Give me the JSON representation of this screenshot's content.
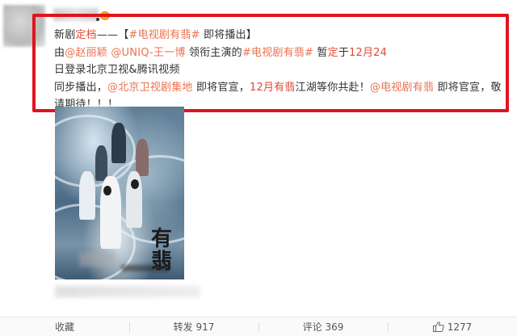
{
  "post": {
    "avatar": "blurred-avatar",
    "username": "",
    "line1": [
      {
        "text": "新剧",
        "style": "plain"
      },
      {
        "text": "定档",
        "style": "red"
      },
      {
        "text": "——【",
        "style": "plain"
      },
      {
        "text": "#电视剧有翡#",
        "style": "link"
      },
      {
        "text": " 即将播出】",
        "style": "plain"
      }
    ],
    "line2": [
      {
        "text": "由",
        "style": "plain"
      },
      {
        "text": "@赵丽颖",
        "style": "link"
      },
      {
        "text": " ",
        "style": "plain"
      },
      {
        "text": "@UNIQ-王一博",
        "style": "link"
      },
      {
        "text": " 领衔主演的",
        "style": "plain"
      },
      {
        "text": "#电视剧有翡#",
        "style": "link"
      },
      {
        "text": " 暂",
        "style": "plain"
      },
      {
        "text": "定",
        "style": "red"
      },
      {
        "text": "于",
        "style": "plain"
      },
      {
        "text": "12月24",
        "style": "red"
      },
      {
        "text": "日登录北京卫视&腾讯视频",
        "style": "plain"
      }
    ],
    "line3": [
      {
        "text": "同步播出，",
        "style": "plain"
      },
      {
        "text": "@北京卫视剧集地",
        "style": "link"
      },
      {
        "text": " 即将官宣，",
        "style": "plain"
      },
      {
        "text": "12月有翡",
        "style": "red"
      },
      {
        "text": "江湖等你共赴！",
        "style": "plain"
      },
      {
        "text": "@电视剧有翡",
        "style": "link"
      },
      {
        "text": " 即将官宣，敬",
        "style": "plain"
      }
    ],
    "line4": [
      {
        "text": "请期待！！！",
        "style": "plain"
      }
    ],
    "poster_title": "有翡"
  },
  "actions": {
    "favorite_label": "收藏",
    "repost_label": "转发 917",
    "comment_label": "评论 369",
    "like_count": "1277"
  },
  "colors": {
    "highlight_red": "#e04a3a",
    "link_orange": "#eb7350",
    "frame_red": "#e0141e"
  }
}
